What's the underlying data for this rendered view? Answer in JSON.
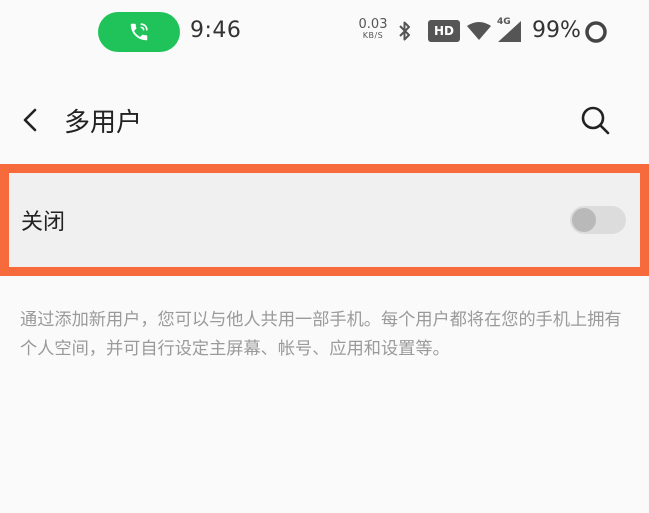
{
  "status_bar": {
    "time": "9:46",
    "net_speed_value": "0.03",
    "net_speed_unit": "KB/S",
    "hd_badge": "HD",
    "network_type": "4G",
    "battery": "99%",
    "call_pill_color": "#20c35a",
    "icons": [
      "phone-call-icon",
      "bluetooth-icon",
      "wifi-icon",
      "signal-icon",
      "battery-ring-icon"
    ]
  },
  "header": {
    "title": "多用户",
    "back_icon": "chevron-left-icon",
    "search_icon": "search-icon"
  },
  "setting": {
    "label": "关闭",
    "toggle_on": false,
    "highlight_color": "#f76a3c"
  },
  "description": "通过添加新用户，您可以与他人共用一部手机。每个用户都将在您的手机上拥有个人空间，并可自行设定主屏幕、帐号、应用和设置等。"
}
